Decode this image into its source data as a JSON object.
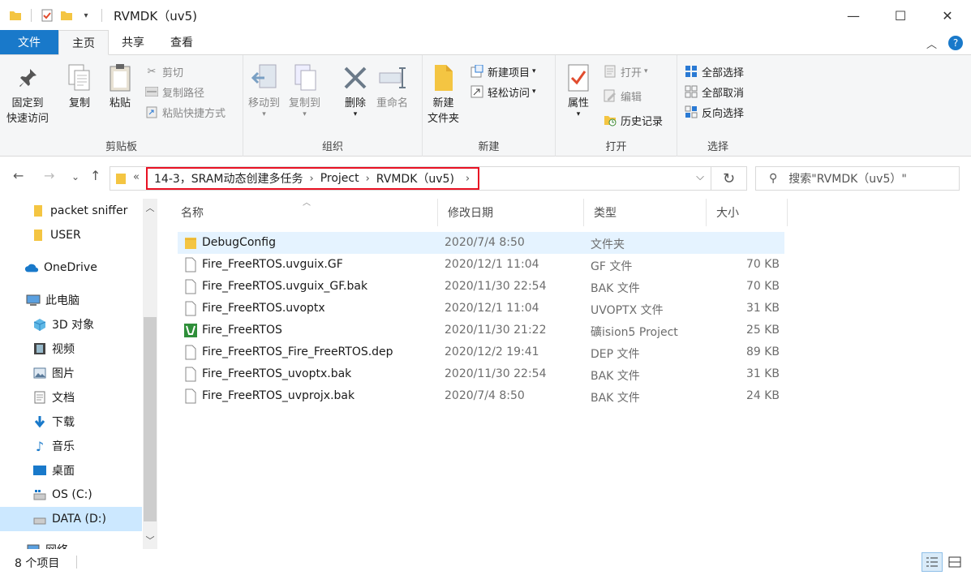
{
  "window": {
    "title": "RVMDK（uv5)",
    "minimize": "—",
    "maximize": "☐",
    "close": "✕"
  },
  "tabs": [
    "文件",
    "主页",
    "共享",
    "查看"
  ],
  "ribbon": {
    "clipboard": {
      "label": "剪贴板",
      "pin_line1": "固定到",
      "pin_line2": "快速访问",
      "copy": "复制",
      "paste": "粘贴",
      "cut": "剪切",
      "copy_path": "复制路径",
      "paste_shortcut": "粘贴快捷方式"
    },
    "organize": {
      "label": "组织",
      "move_to": "移动到",
      "copy_to": "复制到",
      "delete": "删除",
      "rename": "重命名"
    },
    "new": {
      "label": "新建",
      "new_folder_line1": "新建",
      "new_folder_line2": "文件夹",
      "new_item": "新建项目",
      "easy_access": "轻松访问"
    },
    "open": {
      "label": "打开",
      "properties": "属性",
      "open": "打开",
      "edit": "编辑",
      "history": "历史记录"
    },
    "select": {
      "label": "选择",
      "select_all": "全部选择",
      "select_none": "全部取消",
      "invert": "反向选择"
    }
  },
  "address": {
    "overflow": "«",
    "crumbs": [
      "14-3，SRAM动态创建多任务",
      "Project",
      "RVMDK（uv5)"
    ],
    "search_placeholder": "搜索\"RVMDK（uv5）\""
  },
  "nav_pane": {
    "items": [
      {
        "label": "packet sniffer",
        "icon": "folder-icon"
      },
      {
        "label": "USER",
        "icon": "folder-icon"
      },
      {
        "label": "OneDrive",
        "icon": "cloud-icon"
      },
      {
        "label": "此电脑",
        "icon": "computer-icon"
      },
      {
        "label": "3D 对象",
        "icon": "cube-icon"
      },
      {
        "label": "视频",
        "icon": "video-icon"
      },
      {
        "label": "图片",
        "icon": "picture-icon"
      },
      {
        "label": "文档",
        "icon": "document-icon"
      },
      {
        "label": "下载",
        "icon": "download-icon"
      },
      {
        "label": "音乐",
        "icon": "music-icon"
      },
      {
        "label": "桌面",
        "icon": "desktop-icon"
      },
      {
        "label": "OS (C:)",
        "icon": "drive-icon"
      },
      {
        "label": "DATA (D:)",
        "icon": "drive-icon"
      },
      {
        "label": "网络",
        "icon": "network-icon"
      }
    ]
  },
  "file_list": {
    "columns": [
      "名称",
      "修改日期",
      "类型",
      "大小"
    ],
    "rows": [
      {
        "name": "DebugConfig",
        "date": "2020/7/4 8:50",
        "type": "文件夹",
        "size": "",
        "icon": "folder-icon"
      },
      {
        "name": "Fire_FreeRTOS.uvguix.GF",
        "date": "2020/12/1 11:04",
        "type": "GF 文件",
        "size": "70 KB",
        "icon": "file-icon"
      },
      {
        "name": "Fire_FreeRTOS.uvguix_GF.bak",
        "date": "2020/11/30 22:54",
        "type": "BAK 文件",
        "size": "70 KB",
        "icon": "file-icon"
      },
      {
        "name": "Fire_FreeRTOS.uvoptx",
        "date": "2020/12/1 11:04",
        "type": "UVOPTX 文件",
        "size": "31 KB",
        "icon": "file-icon"
      },
      {
        "name": "Fire_FreeRTOS",
        "date": "2020/11/30 21:22",
        "type": "礦ision5 Project",
        "size": "25 KB",
        "icon": "keil-project-icon"
      },
      {
        "name": "Fire_FreeRTOS_Fire_FreeRTOS.dep",
        "date": "2020/12/2 19:41",
        "type": "DEP 文件",
        "size": "89 KB",
        "icon": "file-icon"
      },
      {
        "name": "Fire_FreeRTOS_uvoptx.bak",
        "date": "2020/11/30 22:54",
        "type": "BAK 文件",
        "size": "31 KB",
        "icon": "file-icon"
      },
      {
        "name": "Fire_FreeRTOS_uvprojx.bak",
        "date": "2020/7/4 8:50",
        "type": "BAK 文件",
        "size": "24 KB",
        "icon": "file-icon"
      }
    ]
  },
  "status": {
    "count": "8 个项目"
  },
  "colors": {
    "accent": "#1979ca",
    "highlight_row": "#e5f3ff",
    "selected_nav": "#cce8ff",
    "address_outline": "#e81123",
    "folder": "#f4c542"
  }
}
